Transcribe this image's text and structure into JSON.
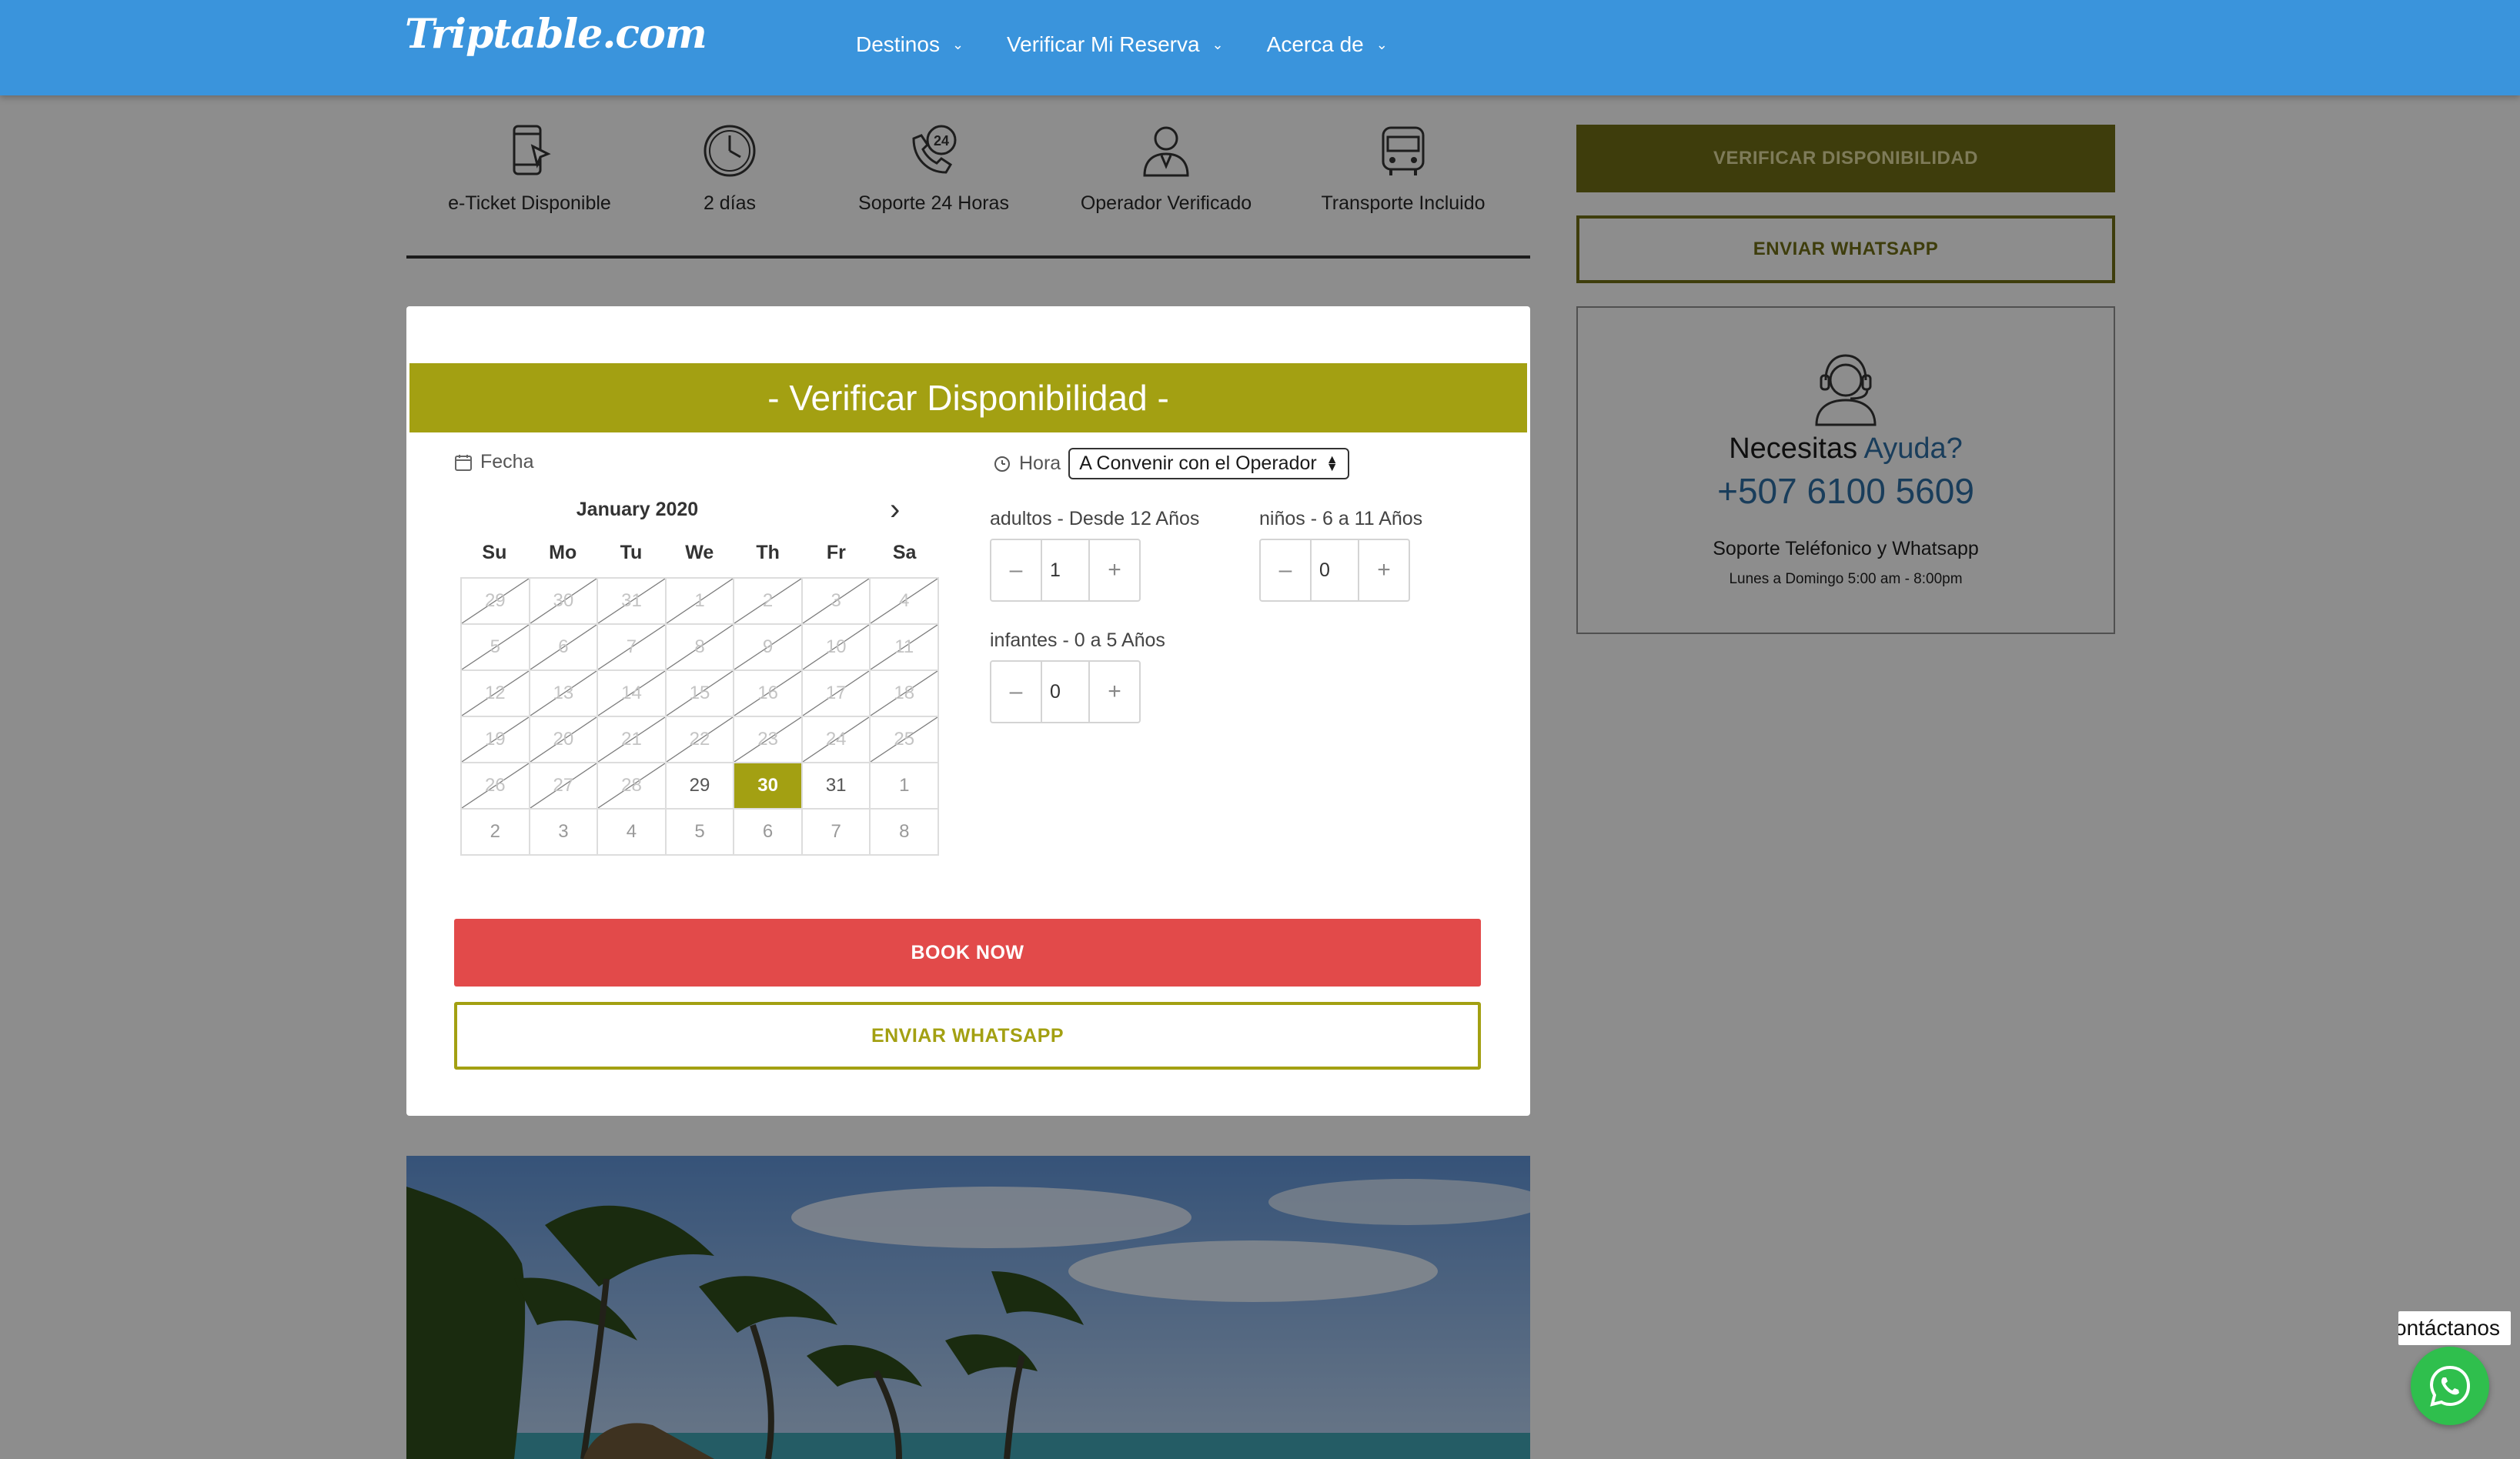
{
  "header": {
    "logo": "Triptable.com",
    "nav": [
      {
        "label": "Destinos"
      },
      {
        "label": "Verificar Mi Reserva"
      },
      {
        "label": "Acerca de"
      }
    ]
  },
  "features": [
    {
      "label": "e-Ticket Disponible",
      "icon": "mobile-ticket-icon"
    },
    {
      "label": "2 días",
      "icon": "clock-icon"
    },
    {
      "label": "Soporte 24 Horas",
      "icon": "phone-24-icon"
    },
    {
      "label": "Operador Verificado",
      "icon": "operator-icon"
    },
    {
      "label": "Transporte Incluido",
      "icon": "bus-icon"
    }
  ],
  "sidebar": {
    "check_button": "VERIFICAR DISPONIBILIDAD",
    "whatsapp_button": "ENVIAR WHATSAPP",
    "help": {
      "title_prefix": "Necesitas",
      "title_accent": "Ayuda?",
      "phone": "+507 6100 5609",
      "subtitle": "Soporte Teléfonico y Whatsapp",
      "hours": "Lunes a Domingo 5:00 am - 8:00pm"
    }
  },
  "booking": {
    "title": "- Verificar Disponibilidad -",
    "date_label": "Fecha",
    "calendar": {
      "month": "January 2020",
      "weekdays": [
        "Su",
        "Mo",
        "Tu",
        "We",
        "Th",
        "Fr",
        "Sa"
      ],
      "weeks": [
        [
          {
            "d": "29",
            "s": "disabled"
          },
          {
            "d": "30",
            "s": "disabled"
          },
          {
            "d": "31",
            "s": "disabled"
          },
          {
            "d": "1",
            "s": "disabled"
          },
          {
            "d": "2",
            "s": "disabled"
          },
          {
            "d": "3",
            "s": "disabled"
          },
          {
            "d": "4",
            "s": "disabled"
          }
        ],
        [
          {
            "d": "5",
            "s": "disabled"
          },
          {
            "d": "6",
            "s": "disabled"
          },
          {
            "d": "7",
            "s": "disabled"
          },
          {
            "d": "8",
            "s": "disabled"
          },
          {
            "d": "9",
            "s": "disabled"
          },
          {
            "d": "10",
            "s": "disabled"
          },
          {
            "d": "11",
            "s": "disabled"
          }
        ],
        [
          {
            "d": "12",
            "s": "disabled"
          },
          {
            "d": "13",
            "s": "disabled"
          },
          {
            "d": "14",
            "s": "disabled"
          },
          {
            "d": "15",
            "s": "disabled"
          },
          {
            "d": "16",
            "s": "disabled"
          },
          {
            "d": "17",
            "s": "disabled"
          },
          {
            "d": "18",
            "s": "disabled"
          }
        ],
        [
          {
            "d": "19",
            "s": "disabled"
          },
          {
            "d": "20",
            "s": "disabled"
          },
          {
            "d": "21",
            "s": "disabled"
          },
          {
            "d": "22",
            "s": "disabled"
          },
          {
            "d": "23",
            "s": "disabled"
          },
          {
            "d": "24",
            "s": "disabled"
          },
          {
            "d": "25",
            "s": "disabled"
          }
        ],
        [
          {
            "d": "26",
            "s": "disabled"
          },
          {
            "d": "27",
            "s": "disabled"
          },
          {
            "d": "28",
            "s": "disabled"
          },
          {
            "d": "29",
            "s": "available"
          },
          {
            "d": "30",
            "s": "selected"
          },
          {
            "d": "31",
            "s": "available"
          },
          {
            "d": "1",
            "s": "muted"
          }
        ],
        [
          {
            "d": "2",
            "s": "muted"
          },
          {
            "d": "3",
            "s": "muted"
          },
          {
            "d": "4",
            "s": "muted"
          },
          {
            "d": "5",
            "s": "muted"
          },
          {
            "d": "6",
            "s": "muted"
          },
          {
            "d": "7",
            "s": "muted"
          },
          {
            "d": "8",
            "s": "muted"
          }
        ]
      ]
    },
    "time_label": "Hora",
    "time_value": "A Convenir con el Operador",
    "quantities": [
      {
        "label": "adultos - Desde 12 Años",
        "value": "1"
      },
      {
        "label": "niños - 6 a 11 Años",
        "value": "0"
      },
      {
        "label": "infantes - 0 a 5 Años",
        "value": "0"
      }
    ],
    "book_button": "BOOK NOW",
    "whatsapp_button": "ENVIAR WHATSAPP"
  },
  "whatsapp_widget": {
    "tooltip": "Contáctanos"
  },
  "colors": {
    "nav_blue": "#3a94dc",
    "olive": "#a3a012",
    "dark_olive": "#6b6a16",
    "book_red": "#e24a4a",
    "whatsapp_green": "#2fbf4d",
    "link_blue": "#2c6a9e"
  }
}
